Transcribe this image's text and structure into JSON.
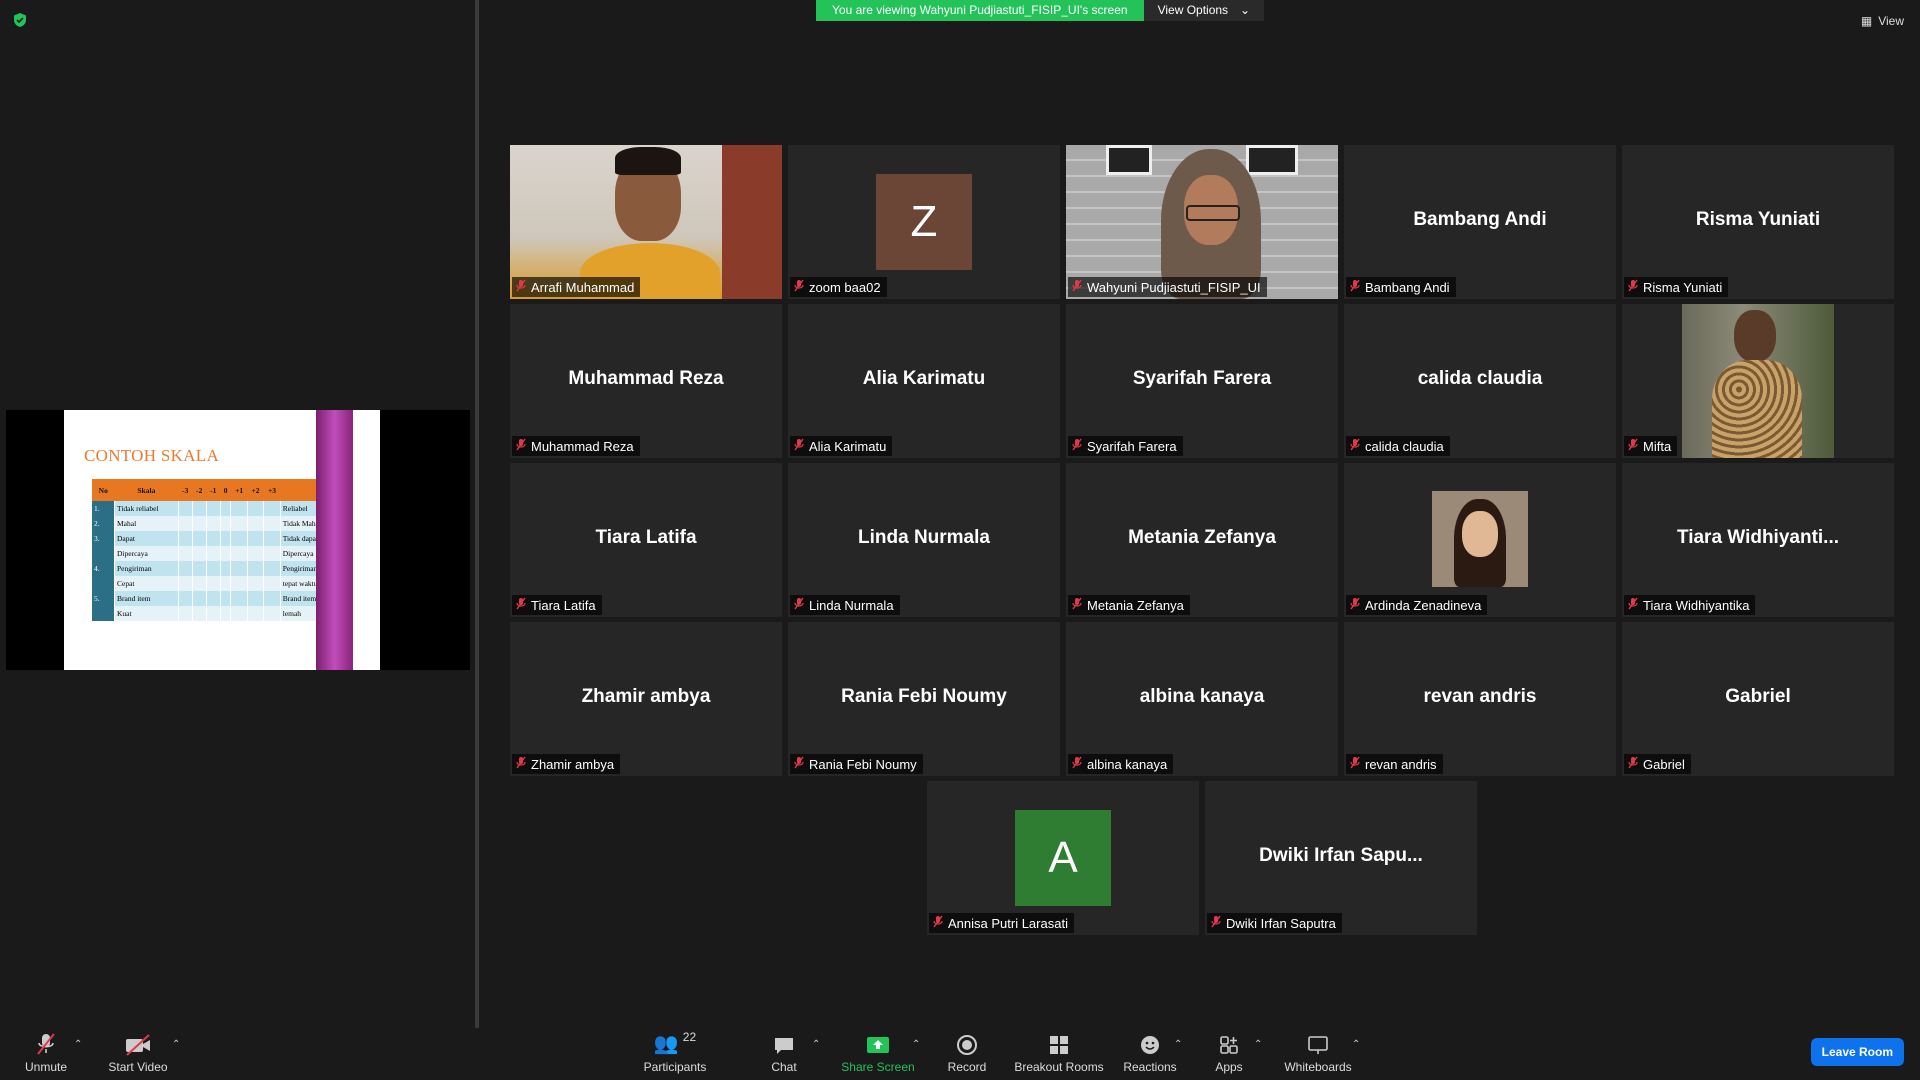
{
  "banner": {
    "viewing_text": "You are viewing Wahyuni Pudjiastuti_FISIP_UI's screen",
    "view_options": "View Options",
    "view": "View"
  },
  "share": {
    "title": "CONTOH SKALA",
    "headers": [
      "No",
      "Skala",
      "-3",
      "-2",
      "-1",
      "0",
      "+1",
      "+2",
      "+3",
      ""
    ],
    "rows": [
      [
        "1.",
        "Tidak reliabel",
        "Reliabel"
      ],
      [
        "2.",
        "Mahal",
        "Tidak Mahal"
      ],
      [
        "3.",
        "Dapat",
        "Tidak dapat"
      ],
      [
        "",
        "Dipercaya",
        "Dipercaya"
      ],
      [
        "4.",
        "Pengiriman",
        "Pengiriman"
      ],
      [
        "",
        "Cepat",
        "tepat waktu"
      ],
      [
        "5.",
        "Brand item",
        "Brand item"
      ],
      [
        "",
        "Kuat",
        "lemah"
      ]
    ]
  },
  "tiles": [
    {
      "name": "",
      "label": "Arrafi Muhammad"
    },
    {
      "name": "",
      "label": "zoom baa02",
      "letter": "Z"
    },
    {
      "name": "",
      "label": "Wahyuni Pudjiastuti_FISIP_UI"
    },
    {
      "name": "Bambang Andi",
      "label": "Bambang Andi"
    },
    {
      "name": "Risma Yuniati",
      "label": "Risma Yuniati"
    },
    {
      "name": "Muhammad Reza",
      "label": "Muhammad Reza"
    },
    {
      "name": "Alia Karimatu",
      "label": "Alia Karimatu"
    },
    {
      "name": "Syarifah Farera",
      "label": "Syarifah Farera"
    },
    {
      "name": "calida claudia",
      "label": "calida claudia"
    },
    {
      "name": "",
      "label": "Mifta"
    },
    {
      "name": "Tiara Latifa",
      "label": "Tiara Latifa"
    },
    {
      "name": "Linda Nurmala",
      "label": "Linda Nurmala"
    },
    {
      "name": "Metania Zefanya",
      "label": "Metania Zefanya"
    },
    {
      "name": "",
      "label": "Ardinda Zenadineva"
    },
    {
      "name": "Tiara  Widhiyanti...",
      "label": "Tiara Widhiyantika"
    },
    {
      "name": "Zhamir ambya",
      "label": "Zhamir ambya"
    },
    {
      "name": "Rania Febi Noumy",
      "label": "Rania Febi Noumy"
    },
    {
      "name": "albina kanaya",
      "label": "albina kanaya"
    },
    {
      "name": "revan andris",
      "label": "revan andris"
    },
    {
      "name": "Gabriel",
      "label": "Gabriel"
    },
    {
      "name": "",
      "label": "Annisa Putri Larasati",
      "letter": "A"
    },
    {
      "name": "Dwiki  Irfan Sapu...",
      "label": "Dwiki Irfan Saputra"
    }
  ],
  "toolbar": {
    "unmute": "Unmute",
    "start_video": "Start Video",
    "participants": "Participants",
    "participants_count": "22",
    "chat": "Chat",
    "share_screen": "Share Screen",
    "record": "Record",
    "breakout_rooms": "Breakout Rooms",
    "reactions": "Reactions",
    "apps": "Apps",
    "whiteboards": "Whiteboards",
    "leave_room": "Leave Room"
  },
  "colors": {
    "accent_green": "#23c35a",
    "active_speaker": "#e6f77a",
    "leave_blue": "#0e72ed",
    "z_avatar": "#6b4637",
    "a_avatar": "#2e7d32"
  }
}
